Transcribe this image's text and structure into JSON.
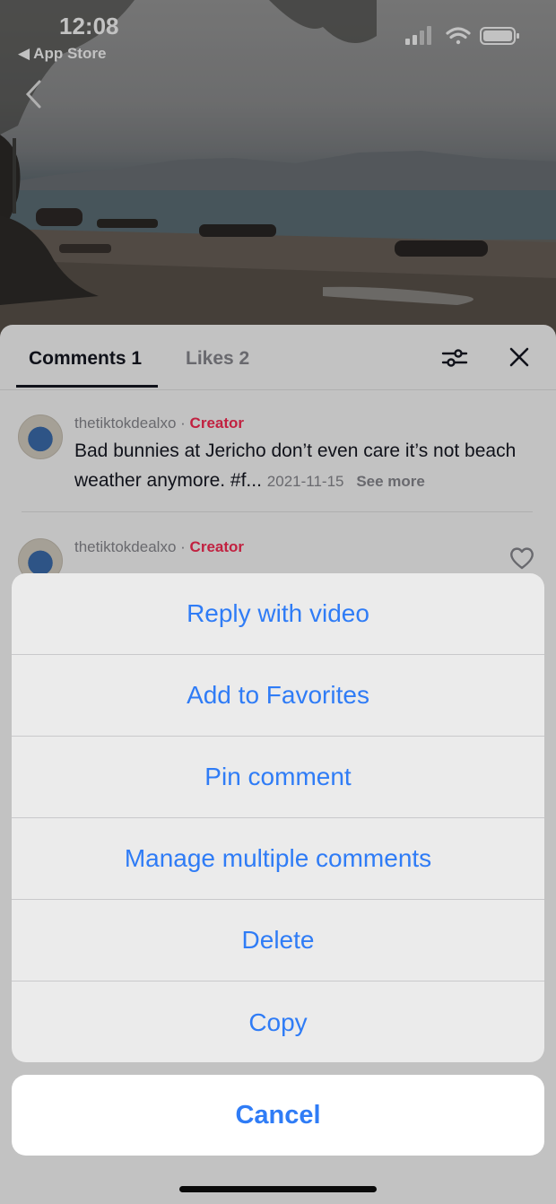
{
  "status_bar": {
    "time": "12:08",
    "back_app": "App Store"
  },
  "tabs": {
    "comments_label": "Comments 1",
    "likes_label": "Likes 2"
  },
  "comments": [
    {
      "username": "thetiktokdealxo",
      "separator": "·",
      "badge": "Creator",
      "text": "Bad bunnies at Jericho don’t even care it’s not beach weather anymore. #f...",
      "date": "2021-11-15",
      "see_more": "See more"
    },
    {
      "username": "thetiktokdealxo",
      "separator": "·",
      "badge": "Creator"
    }
  ],
  "action_sheet": {
    "items": [
      "Reply with video",
      "Add to Favorites",
      "Pin comment",
      "Manage multiple comments",
      "Delete",
      "Copy"
    ],
    "cancel_label": "Cancel"
  },
  "colors": {
    "action_blue": "#2f7cf6",
    "creator_red": "#fe2c55",
    "text_dark": "#161823",
    "text_muted": "#8a8b91"
  }
}
